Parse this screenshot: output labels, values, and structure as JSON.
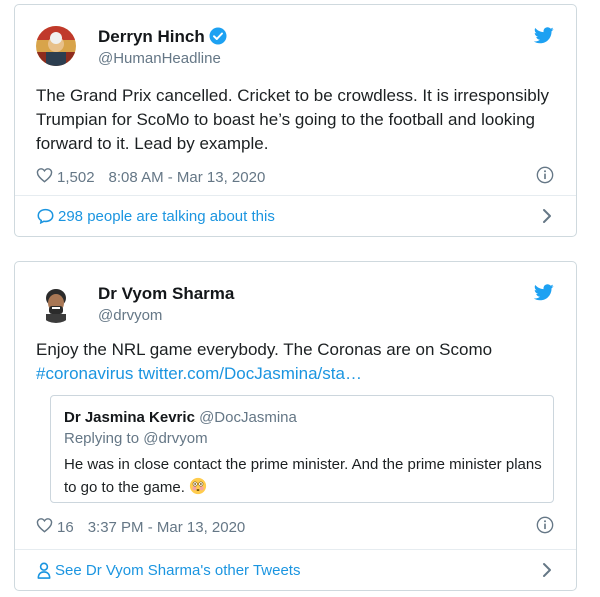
{
  "tweet1": {
    "author_name": "Derryn Hinch",
    "handle": "@HumanHeadline",
    "text": "The Grand Prix cancelled. Cricket to be crowdless. It is irresponsibly Trumpian for ScoMo to boast he’s going to the football and looking forward to it. Lead by example.",
    "likes": "1,502",
    "timestamp": "8:08 AM - Mar 13, 2020",
    "footer_label": "298 people are talking about this",
    "icons": {
      "verified": "verified-badge-icon",
      "bird": "twitter-bird-icon",
      "heart": "heart-icon",
      "info": "info-icon",
      "chat": "comment-bubble-icon",
      "chevron": "chevron-right-icon"
    }
  },
  "tweet2": {
    "author_name": "Dr Vyom Sharma",
    "handle": "@drvyom",
    "text": "Enjoy the NRL game everybody. The Coronas are on Scomo",
    "hashtag": "#coronavirus",
    "link": "twitter.com/DocJasmina/sta…",
    "quote": {
      "author_name": "Dr Jasmina Kevric",
      "handle": "@DocJasmina",
      "replying": "Replying to @drvyom",
      "text": "He was in close contact the prime minister. And the prime minister plans to go to the game."
    },
    "likes": "16",
    "timestamp": "3:37 PM - Mar 13, 2020",
    "footer_label": "See Dr Vyom Sharma's other Tweets",
    "icons": {
      "bird": "twitter-bird-icon",
      "heart": "heart-icon",
      "info": "info-icon",
      "person": "person-icon",
      "chevron": "chevron-right-icon",
      "emoji": "flushed-face-emoji"
    }
  },
  "colors": {
    "link": "#1b95e0",
    "secondary": "#657786",
    "border": "#cfd9de",
    "text": "#1c2022"
  }
}
